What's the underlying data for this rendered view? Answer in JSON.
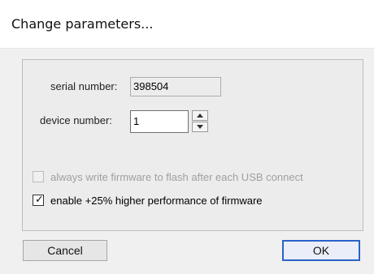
{
  "window": {
    "title": "Change parameters..."
  },
  "fields": {
    "serial_label": "serial number:",
    "serial_value": "398504",
    "device_label": "device number:",
    "device_value": "1"
  },
  "options": [
    {
      "label": "always write firmware to flash after each USB connect",
      "checked": false,
      "enabled": false
    },
    {
      "label": "enable +25% higher performance of firmware",
      "checked": true,
      "enabled": true
    }
  ],
  "buttons": {
    "cancel": "Cancel",
    "ok": "OK"
  },
  "colors": {
    "accent": "#2b62c8"
  }
}
